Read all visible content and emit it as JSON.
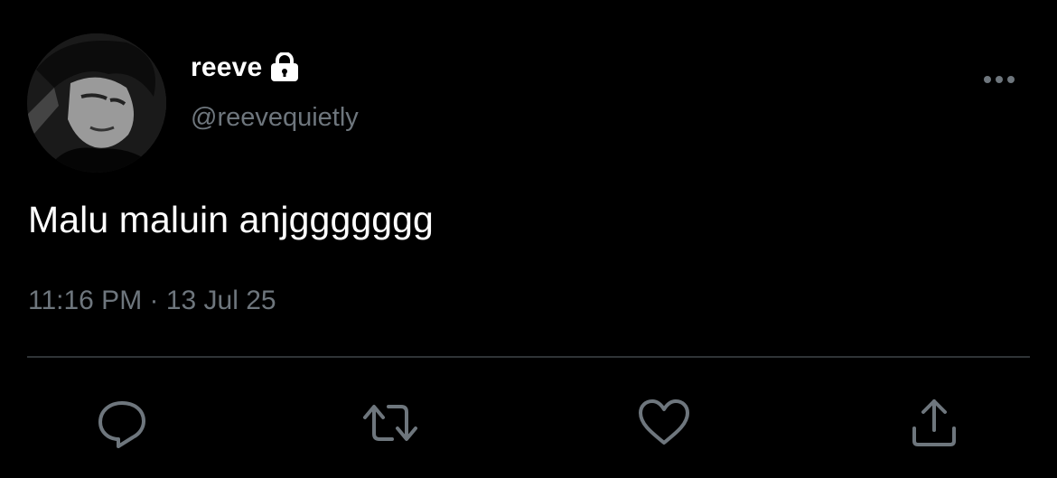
{
  "tweet": {
    "display_name": "reeve",
    "handle": "@reevequietly",
    "text": "Malu maluin anjggggggg",
    "timestamp": "11:16 PM · 13 Jul 25",
    "protected_icon": "lock-icon",
    "more_icon": "more-icon"
  },
  "actions": {
    "reply_icon": "reply-icon",
    "retweet_icon": "retweet-icon",
    "like_icon": "heart-icon",
    "share_icon": "share-icon"
  },
  "colors": {
    "background": "#000000",
    "primary_text": "#ffffff",
    "secondary_text": "#6e767d",
    "divider": "#2f3336"
  }
}
